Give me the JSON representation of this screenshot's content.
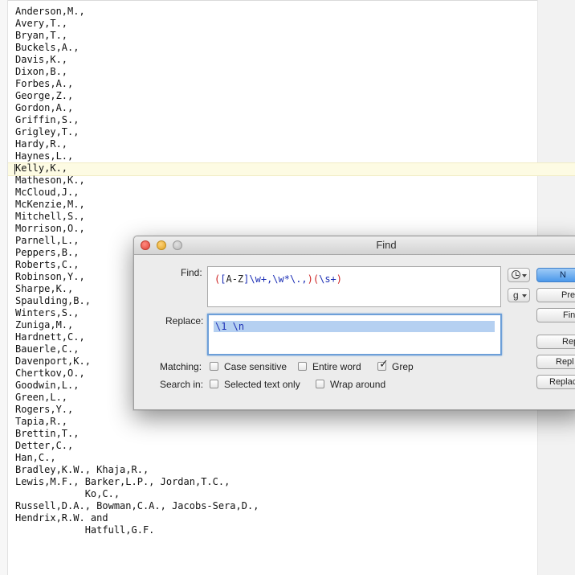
{
  "editor": {
    "lines": [
      "Anderson,M.,",
      "Avery,T.,",
      "Bryan,T.,",
      "Buckels,A.,",
      "Davis,K.,",
      "Dixon,B.,",
      "Forbes,A.,",
      "George,Z.,",
      "Gordon,A.,",
      "Griffin,S.,",
      "Grigley,T.,",
      "Hardy,R.,",
      "Haynes,L.,",
      "Kelly,K.,",
      "Matheson,K.,",
      "McCloud,J.,",
      "McKenzie,M.,",
      "Mitchell,S.,",
      "Morrison,O.,",
      "Parnell,L.,",
      "Peppers,B.,",
      "Roberts,C.,",
      "Robinson,Y.,",
      "Sharpe,K.,",
      "Spaulding,B.,",
      "Winters,S.,",
      "Zuniga,M.,",
      "Hardnett,C.,",
      "Bauerle,C.,",
      "Davenport,K.,",
      "Chertkov,O.,",
      "Goodwin,L.,",
      "Green,L.,",
      "Rogers,Y.,",
      "Tapia,R.,",
      "Brettin,T.,",
      "Detter,C.,",
      "Han,C.,",
      "Bradley,K.W., Khaja,R.,",
      "Lewis,M.F., Barker,L.P., Jordan,T.C.,",
      "            Ko,C.,",
      "Russell,D.A., Bowman,C.A., Jacobs-Sera,D.,",
      "Hendrix,R.W. and",
      "            Hatfull,G.F."
    ],
    "current_line_index": 13
  },
  "find_dialog": {
    "title": "Find",
    "find_label": "Find:",
    "find_value": {
      "p1": "(",
      "b1": "[",
      "k1": "A-Z",
      "b2": "]",
      "k2": "\\w+,\\w*\\.,",
      "p2": ")(",
      "k3": "\\s+",
      "p3": ")"
    },
    "replace_label": "Replace:",
    "replace_value": "\\1 \\n",
    "history_icon": "clock-icon",
    "grep_menu_label": "g",
    "matching_label": "Matching:",
    "search_in_label": "Search in:",
    "options": {
      "case_sensitive": {
        "label": "Case sensitive",
        "checked": false
      },
      "entire_word": {
        "label": "Entire word",
        "checked": false
      },
      "grep": {
        "label": "Grep",
        "checked": true
      },
      "selected_text_only": {
        "label": "Selected text only",
        "checked": false
      },
      "wrap_around": {
        "label": "Wrap around",
        "checked": false
      }
    },
    "buttons": {
      "next": "N",
      "previous": "Pre",
      "find_all": "Fin",
      "replace": "Rep",
      "replace_find": "Repl",
      "replace_all": "Replac"
    },
    "colors": {
      "accent": "#4b98ea",
      "regex_paren": "#cc1f1f",
      "regex_bracket": "#1c2fb5",
      "selection": "#b5d0f1",
      "current_line": "#fdfbe3"
    }
  }
}
